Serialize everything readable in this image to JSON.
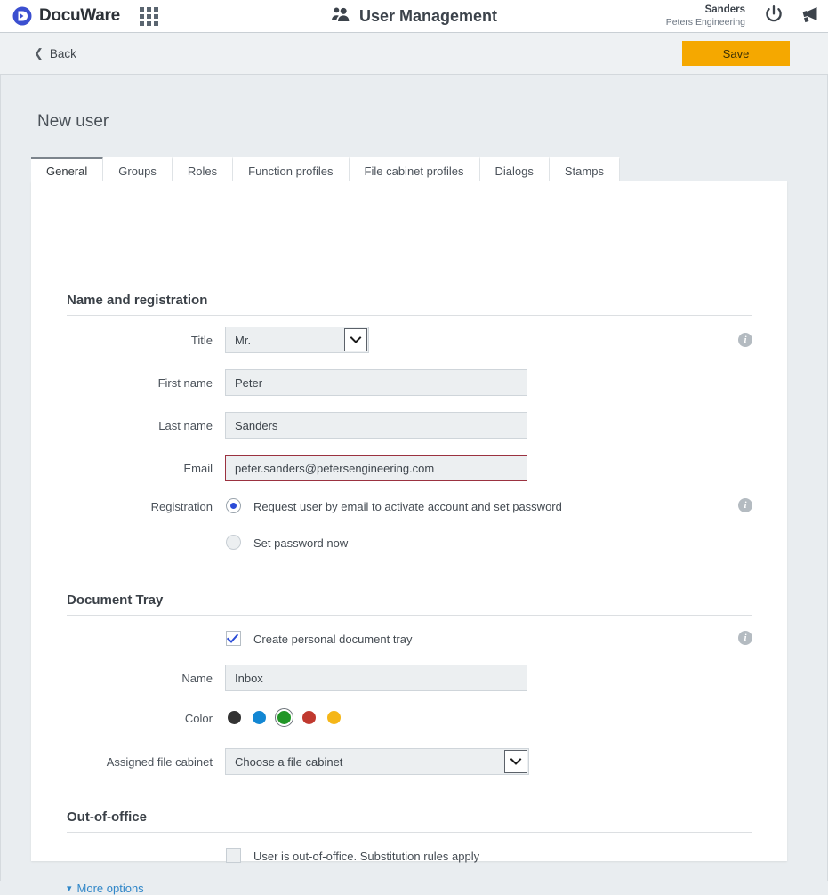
{
  "appbar": {
    "brand": "DocuWare",
    "grid_icon": "apps-grid-icon",
    "title": "User Management",
    "title_icon": "users-icon",
    "user_name": "Sanders",
    "organization": "Peters Engineering",
    "power_icon": "power-icon",
    "announcement_icon": "megaphone-icon",
    "brand_color": "#3b4fd0"
  },
  "commandbar": {
    "back_label": "Back",
    "back_icon": "chevron-left-icon",
    "save_label": "Save",
    "save_color": "#f5a800"
  },
  "page": {
    "title": "New user"
  },
  "tabs": [
    {
      "label": "General",
      "active": true
    },
    {
      "label": "Groups",
      "active": false
    },
    {
      "label": "Roles",
      "active": false
    },
    {
      "label": "Function profiles",
      "active": false
    },
    {
      "label": "File cabinet profiles",
      "active": false
    },
    {
      "label": "Dialogs",
      "active": false
    },
    {
      "label": "Stamps",
      "active": false
    }
  ],
  "sections": {
    "name_registration": {
      "title": "Name and registration",
      "title_label": "Title",
      "title_value": "Mr.",
      "first_name_label": "First name",
      "first_name_value": "Peter",
      "last_name_label": "Last name",
      "last_name_value": "Sanders",
      "email_label": "Email",
      "email_value": "peter.sanders@petersengineering.com",
      "email_border_color": "#9b3240",
      "registration_label": "Registration",
      "registration_option_1": "Request user by email to activate account and set password",
      "registration_option_2": "Set password now",
      "registration_selected": 1
    },
    "document_tray": {
      "title": "Document Tray",
      "create_tray_label": "Create personal document tray",
      "create_tray_checked": true,
      "name_label": "Name",
      "name_value": "Inbox",
      "color_label": "Color",
      "colors": [
        "#333333",
        "#1387d3",
        "#219627",
        "#c0392f",
        "#f5b618"
      ],
      "color_selected_index": 2,
      "cabinet_label": "Assigned file cabinet",
      "cabinet_value": "Choose a file cabinet"
    },
    "out_of_office": {
      "title": "Out-of-office",
      "checkbox_label": "User is out-of-office. Substitution rules apply",
      "checked": false
    },
    "more_options": {
      "label": "More options",
      "icon": "chevron-down-icon",
      "color": "#2f86c8"
    }
  },
  "info_tooltip_glyph": "i"
}
